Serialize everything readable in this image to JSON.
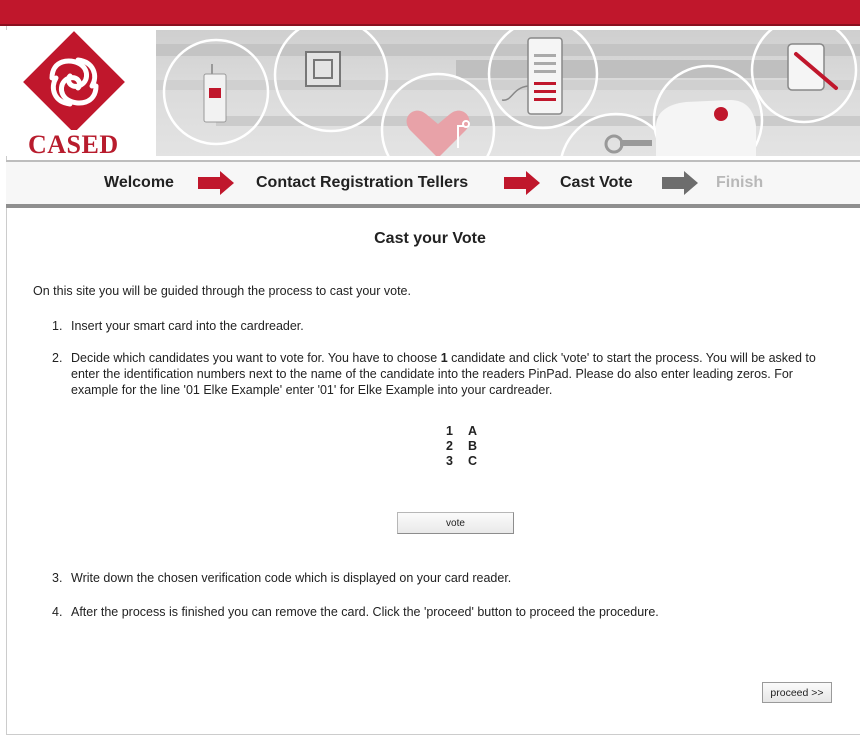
{
  "logo": {
    "text": "CASED"
  },
  "nav": {
    "steps": [
      {
        "label": "Welcome",
        "state": "done"
      },
      {
        "label": "Contact Registration Tellers",
        "state": "done"
      },
      {
        "label": "Cast Vote",
        "state": "current"
      },
      {
        "label": "Finish",
        "state": "upcoming"
      }
    ]
  },
  "main": {
    "title": "Cast your Vote",
    "intro": "On this site you will be guided through the process to cast your vote.",
    "steps": [
      {
        "num": "1.",
        "text": "Insert your smart card into the cardreader."
      },
      {
        "num": "2.",
        "text_before": "Decide which candidates you want to vote for. You have to choose ",
        "count": "1",
        "text_after": " candidate and click 'vote' to start the process. You will be asked to enter the identification numbers next to the name of the candidate into the readers PinPad. Please do also enter leading zeros. For example for the line '01 Elke Example' enter '01' for Elke Example into your cardreader."
      },
      {
        "num": "3.",
        "text": "Write down the chosen verification code which is displayed on your card reader."
      },
      {
        "num": "4.",
        "text": "After the process is finished you can remove the card. Click the 'proceed' button to proceed the procedure."
      }
    ],
    "candidates": [
      {
        "id": "1",
        "name": "A"
      },
      {
        "id": "2",
        "name": "B"
      },
      {
        "id": "3",
        "name": "C"
      }
    ],
    "vote_label": "vote",
    "proceed_label": "proceed >>"
  },
  "colors": {
    "brand_red": "#c0172c",
    "inactive_grey": "#b8b8b8"
  }
}
